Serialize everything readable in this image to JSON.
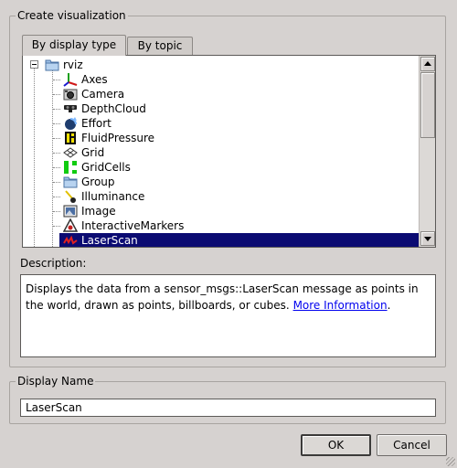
{
  "create_group": {
    "title": "Create visualization",
    "tabs": [
      {
        "label": "By display type",
        "active": true
      },
      {
        "label": "By topic",
        "active": false
      }
    ],
    "tree": {
      "root": {
        "label": "rviz",
        "icon": "folder-icon",
        "expanded": true
      },
      "items": [
        {
          "label": "Axes",
          "icon": "axes-icon"
        },
        {
          "label": "Camera",
          "icon": "camera-icon"
        },
        {
          "label": "DepthCloud",
          "icon": "depthcloud-icon"
        },
        {
          "label": "Effort",
          "icon": "effort-icon"
        },
        {
          "label": "FluidPressure",
          "icon": "fluid-pressure-icon"
        },
        {
          "label": "Grid",
          "icon": "grid-icon"
        },
        {
          "label": "GridCells",
          "icon": "gridcells-icon"
        },
        {
          "label": "Group",
          "icon": "folder-icon"
        },
        {
          "label": "Illuminance",
          "icon": "illuminance-icon"
        },
        {
          "label": "Image",
          "icon": "image-icon"
        },
        {
          "label": "InteractiveMarkers",
          "icon": "interactive-markers-icon"
        },
        {
          "label": "LaserScan",
          "icon": "laserscan-icon",
          "selected": true
        }
      ]
    },
    "description_label": "Description:",
    "description_text": "Displays the data from a sensor_msgs::LaserScan message as points in the world, drawn as points, billboards, or cubes.",
    "description_link": "More Information",
    "description_end": "."
  },
  "display_group": {
    "title": "Display Name",
    "value": "LaserScan"
  },
  "buttons": {
    "ok": "OK",
    "cancel": "Cancel"
  },
  "colors": {
    "selection": "#0b0b72",
    "link": "#0000ee",
    "background": "#d6d2d0"
  }
}
